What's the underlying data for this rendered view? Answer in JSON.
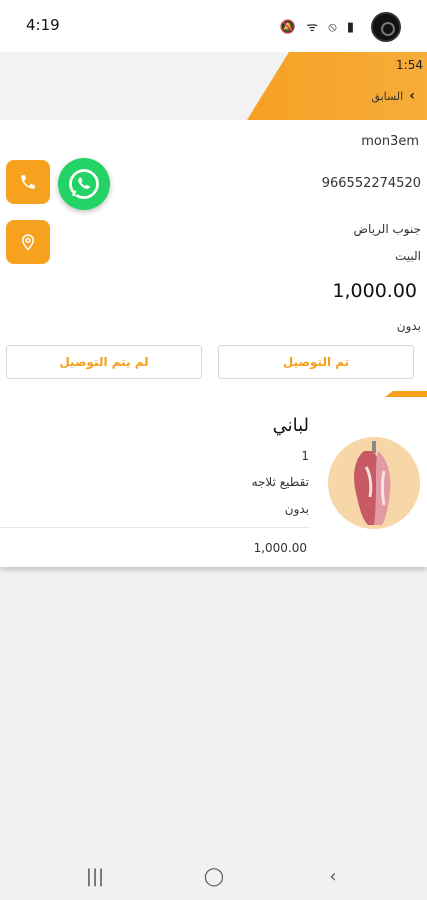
{
  "status_bar": {
    "time": "4:19",
    "icons": "🔕 ᯤ ⦸ ▮"
  },
  "header": {
    "time": "1:54",
    "back_label": "السابق"
  },
  "order": {
    "customer_name": "mon3em",
    "phone": "966552274520",
    "area": "جنوب الرياض",
    "place": "البيت",
    "total": "1,000.00",
    "note": "بدون"
  },
  "actions": {
    "delivered_label": "تم التوصيل",
    "not_delivered_label": "لم يتم التوصيل"
  },
  "product": {
    "name": "لباني",
    "quantity": "1",
    "cut": "تقطيع ثلاجه",
    "note": "بدون",
    "price": "1,000.00"
  },
  "nav": {
    "recent": "|||",
    "home": "◯",
    "back": "‹"
  },
  "colors": {
    "accent": "#f59f1a",
    "whatsapp": "#24d366"
  }
}
